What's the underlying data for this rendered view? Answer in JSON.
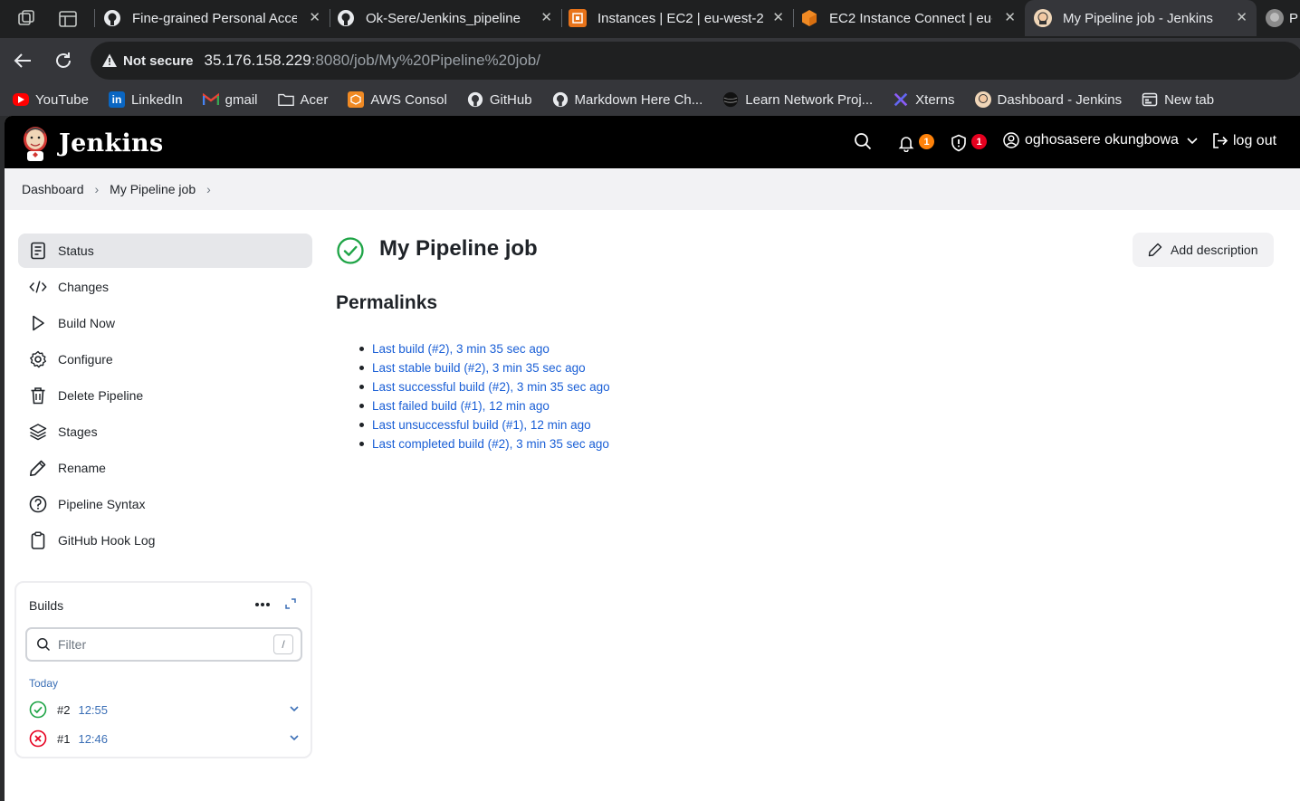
{
  "browser": {
    "tabs": [
      {
        "title": "Fine-grained Personal Acce",
        "icon": "github-icon"
      },
      {
        "title": "Ok-Sere/Jenkins_pipeline",
        "icon": "github-icon"
      },
      {
        "title": "Instances | EC2 | eu-west-2",
        "icon": "aws-ec2-icon"
      },
      {
        "title": "EC2 Instance Connect | eu-",
        "icon": "aws-ec2-cube-icon"
      },
      {
        "title": "My Pipeline job - Jenkins",
        "icon": "jenkins-icon"
      },
      {
        "title": "P",
        "icon": "jenkins-icon"
      }
    ],
    "security_label": "Not secure",
    "url_host": "35.176.158.229",
    "url_rest": ":8080/job/My%20Pipeline%20job/",
    "bookmarks": [
      {
        "label": "YouTube",
        "icon": "youtube-icon"
      },
      {
        "label": "LinkedIn",
        "icon": "linkedin-icon"
      },
      {
        "label": "gmail",
        "icon": "gmail-icon"
      },
      {
        "label": "Acer",
        "icon": "folder-icon"
      },
      {
        "label": "AWS Consol",
        "icon": "aws-icon"
      },
      {
        "label": "GitHub",
        "icon": "github-icon"
      },
      {
        "label": "Markdown Here Ch...",
        "icon": "github-icon"
      },
      {
        "label": "Learn Network Proj...",
        "icon": "globe-icon"
      },
      {
        "label": "Xterns",
        "icon": "xterns-icon"
      },
      {
        "label": "Dashboard - Jenkins",
        "icon": "jenkins-icon"
      },
      {
        "label": "New tab",
        "icon": "newtab-icon"
      }
    ]
  },
  "header": {
    "brand": "Jenkins",
    "notifications_count": "1",
    "security_count": "1",
    "user_name": "oghosasere okungbowa",
    "logout_label": "log out"
  },
  "breadcrumb": [
    "Dashboard",
    "My Pipeline job"
  ],
  "sidebar": {
    "items": [
      {
        "label": "Status",
        "icon": "status-icon"
      },
      {
        "label": "Changes",
        "icon": "code-icon"
      },
      {
        "label": "Build Now",
        "icon": "play-icon"
      },
      {
        "label": "Configure",
        "icon": "gear-icon"
      },
      {
        "label": "Delete Pipeline",
        "icon": "trash-icon"
      },
      {
        "label": "Stages",
        "icon": "layers-icon"
      },
      {
        "label": "Rename",
        "icon": "pencil-icon"
      },
      {
        "label": "Pipeline Syntax",
        "icon": "help-icon"
      },
      {
        "label": "GitHub Hook Log",
        "icon": "clipboard-icon"
      }
    ]
  },
  "builds": {
    "title": "Builds",
    "filter_placeholder": "Filter",
    "filter_shortcut": "/",
    "group_label": "Today",
    "items": [
      {
        "number": "#2",
        "time": "12:55",
        "status": "success"
      },
      {
        "number": "#1",
        "time": "12:46",
        "status": "failed"
      }
    ]
  },
  "main": {
    "title": "My Pipeline job",
    "add_description_label": "Add description",
    "permalinks_heading": "Permalinks",
    "permalinks": [
      "Last build (#2), 3 min 35 sec ago",
      "Last stable build (#2), 3 min 35 sec ago",
      "Last successful build (#2), 3 min 35 sec ago",
      "Last failed build (#1), 12 min ago",
      "Last unsuccessful build (#1), 12 min ago",
      "Last completed build (#2), 3 min 35 sec ago"
    ]
  },
  "colors": {
    "success": "#1ea446",
    "failure": "#e6001f",
    "link": "#1a5fd6",
    "badge_orange": "#fe820a",
    "badge_red": "#e6001f"
  }
}
